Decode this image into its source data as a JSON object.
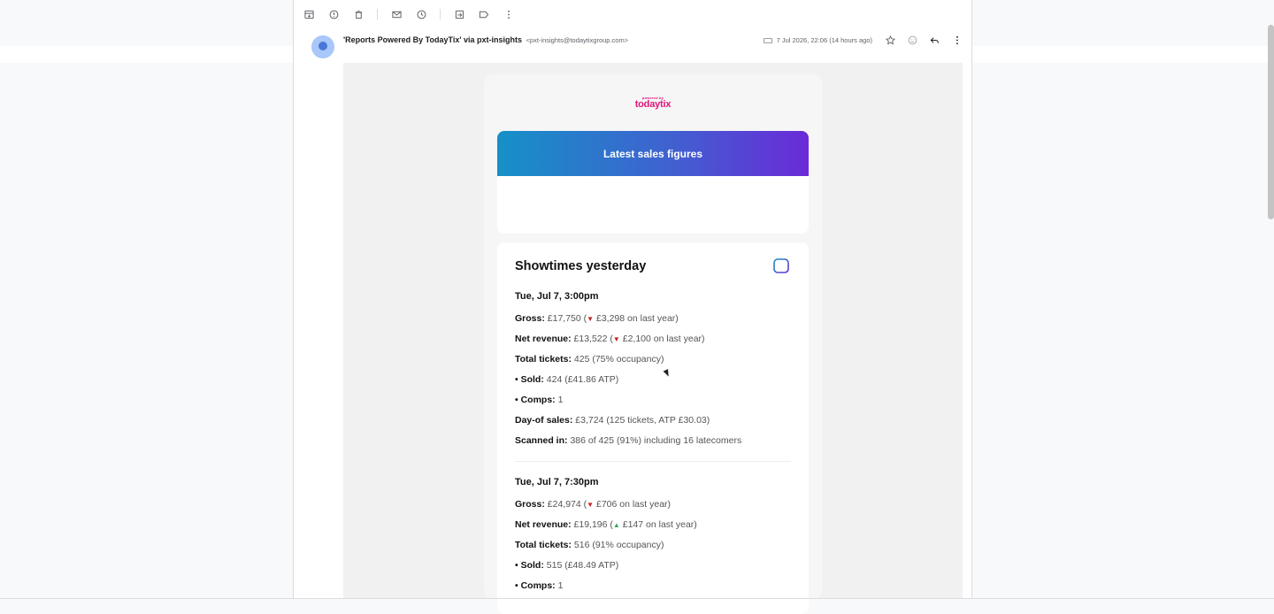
{
  "toolbar": {
    "icons": [
      "archive-icon",
      "report-spam-icon",
      "delete-icon",
      "mark-unread-icon",
      "snooze-icon",
      "move-to-icon",
      "label-icon",
      "more-vert-icon"
    ]
  },
  "message": {
    "sender_name": "'Reports Powered By TodayTix' via pxt-insights",
    "sender_email": "<pxt-insights@todaytixgroup.com>",
    "date": "7 Jul 2026, 22:06 (14 hours ago)"
  },
  "email": {
    "logo_small": "powered by",
    "logo_main": "todaytix",
    "hero_title": "Latest sales figures",
    "section_title": "Showtimes yesterday",
    "shows": [
      {
        "title": "Tue, Jul 7, 3:00pm",
        "gross_label": "Gross:",
        "gross_value": "£17,750 (",
        "gross_arrow": "▼",
        "gross_change": " £3,298 on last year)",
        "net_label": "Net revenue:",
        "net_value": "£13,522 (",
        "net_arrow": "▼",
        "net_change": " £2,100 on last year)",
        "tickets_label": "Total tickets:",
        "tickets_value": "425 (75% occupancy)",
        "sold_label": "• Sold:",
        "sold_value": "424 (£41.86 ATP)",
        "comps_label": "• Comps:",
        "comps_value": "1",
        "dayof_label": "Day-of sales:",
        "dayof_value": "£3,724 (125 tickets, ATP £30.03)",
        "scanned_label": "Scanned in:",
        "scanned_value": "386 of 425 (91%) including 16 latecomers"
      },
      {
        "title": "Tue, Jul 7, 7:30pm",
        "gross_label": "Gross:",
        "gross_value": "£24,974 (",
        "gross_arrow": "▼",
        "gross_change": " £706 on last year)",
        "net_label": "Net revenue:",
        "net_value": "£19,196 (",
        "net_arrow": "▲",
        "net_change": " £147 on last year)",
        "tickets_label": "Total tickets:",
        "tickets_value": "516 (91% occupancy)",
        "sold_label": "• Sold:",
        "sold_value": "515 (£48.49 ATP)",
        "comps_label": "• Comps:",
        "comps_value": "1"
      }
    ]
  },
  "colors": {
    "brand": "#e0157a",
    "hero_start": "#1591c7",
    "hero_end": "#6a2ad8",
    "down": "#c5221f",
    "up": "#34a853"
  }
}
